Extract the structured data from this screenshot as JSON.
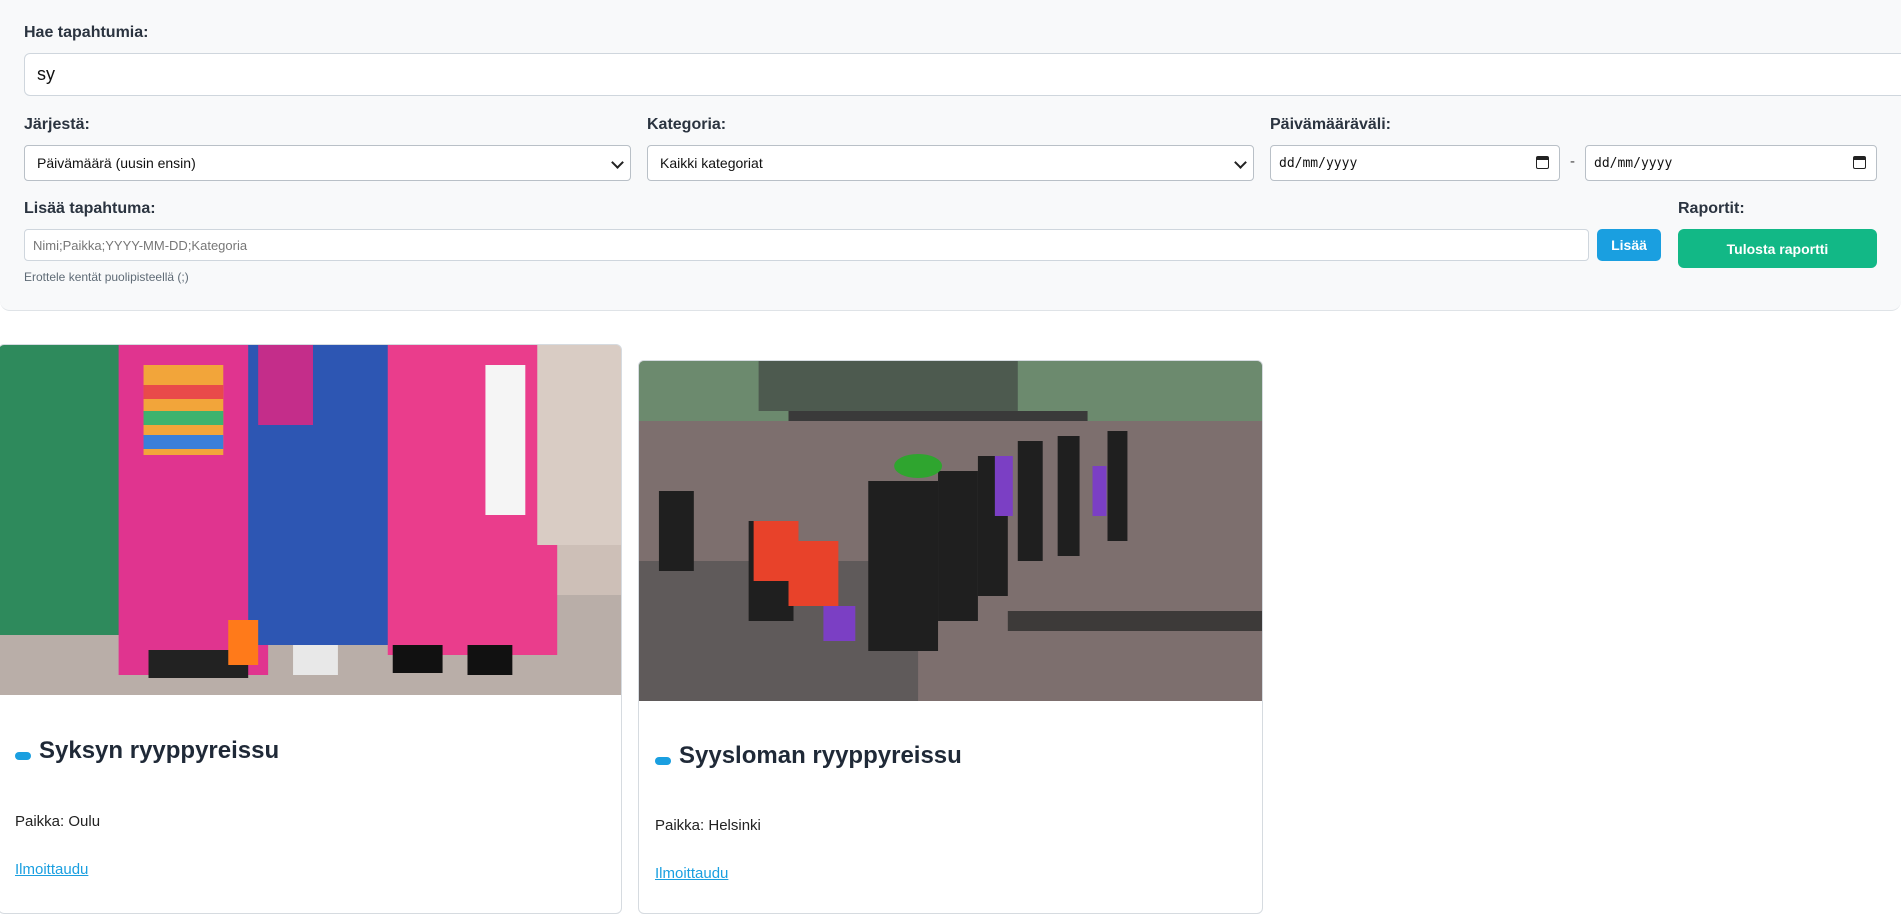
{
  "search": {
    "label": "Hae tapahtumia:",
    "value": "sy"
  },
  "sort": {
    "label": "Järjestä:",
    "selected": "Päivämäärä (uusin ensin)"
  },
  "category": {
    "label": "Kategoria:",
    "selected": "Kaikki kategoriat"
  },
  "date_range": {
    "label": "Päivämääräväli:",
    "from_placeholder": "dd/mm/yyyy",
    "to_placeholder": "dd/mm/yyyy",
    "separator": "-"
  },
  "add_event": {
    "label": "Lisää tapahtuma:",
    "placeholder": "Nimi;Paikka;YYYY-MM-DD;Kategoria",
    "button": "Lisää",
    "hint": "Erottele kentät puolipisteellä (;)"
  },
  "reports": {
    "label": "Raportit:",
    "button": "Tulosta raportti"
  },
  "colors": {
    "accent": "#1a9fe0",
    "report_button": "#12b886"
  },
  "events": [
    {
      "title": "Syksyn ryyppyreissu",
      "place": "Paikka: Oulu",
      "link": "Ilmoittaudu"
    },
    {
      "title": "Syysloman ryyppyreissu",
      "place": "Paikka: Helsinki",
      "link": "Ilmoittaudu"
    }
  ]
}
